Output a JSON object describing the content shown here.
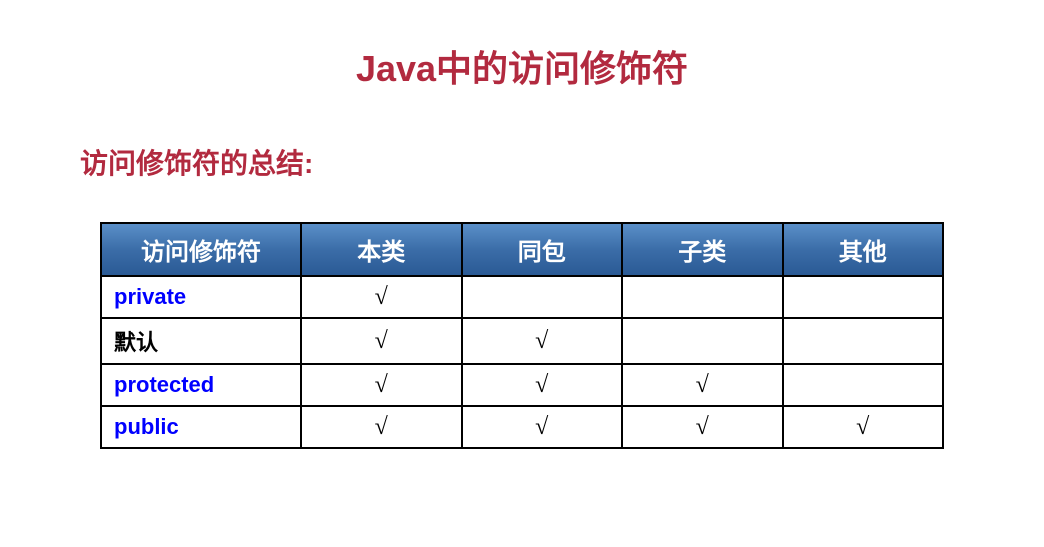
{
  "title": "Java中的访问修饰符",
  "subtitle": "访问修饰符的总结:",
  "table": {
    "headers": [
      "访问修饰符",
      "本类",
      "同包",
      "子类",
      "其他"
    ],
    "rows": [
      {
        "label": "private",
        "labelColor": "blue",
        "cells": [
          "√",
          "",
          "",
          ""
        ]
      },
      {
        "label": "默认",
        "labelColor": "black",
        "cells": [
          "√",
          "√",
          "",
          ""
        ]
      },
      {
        "label": "protected",
        "labelColor": "blue",
        "cells": [
          "√",
          "√",
          "√",
          ""
        ]
      },
      {
        "label": "public",
        "labelColor": "blue",
        "cells": [
          "√",
          "√",
          "√",
          "√"
        ]
      }
    ]
  }
}
